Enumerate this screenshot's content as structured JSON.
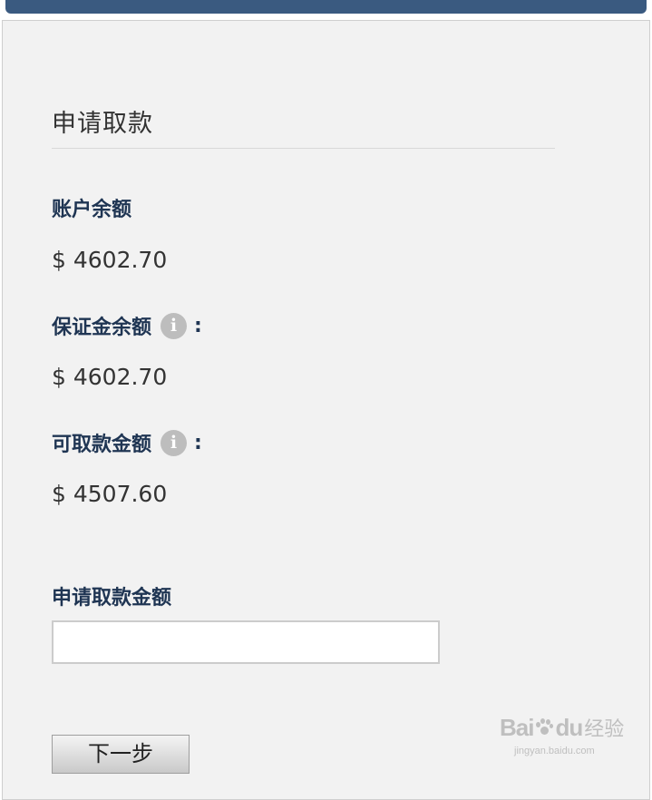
{
  "page": {
    "title": "申请取款"
  },
  "fields": {
    "account_balance": {
      "label": "账户余额",
      "value": "$ 4602.70"
    },
    "margin_balance": {
      "label": "保证金余额",
      "colon": ":",
      "value": "$ 4602.70"
    },
    "withdrawable_amount": {
      "label": "可取款金额",
      "colon": ":",
      "value": "$ 4507.60"
    }
  },
  "withdraw_form": {
    "amount_label": "申请取款金额",
    "amount_value": "",
    "next_button": "下一步"
  },
  "icons": {
    "info_glyph": "i"
  },
  "watermark": {
    "brand_left": "Bai",
    "brand_right": "du",
    "brand_cn": "经验",
    "url": "jingyan.baidu.com"
  },
  "colors": {
    "header_bar": "#3a5a80",
    "label_text": "#1f3553",
    "panel_bg": "#f2f2f2"
  }
}
